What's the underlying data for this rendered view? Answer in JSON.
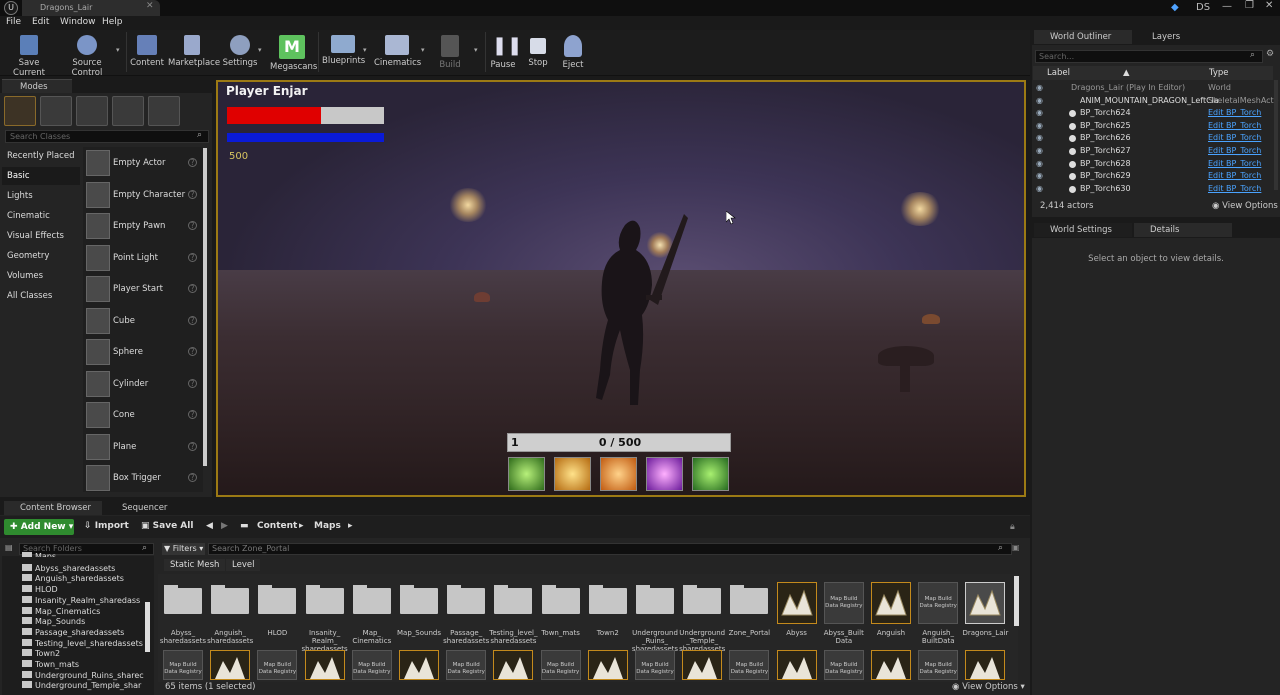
{
  "titlebar": {
    "tab_title": "Dragons_Lair",
    "user_initials": "DS",
    "close": "✕",
    "min": "—",
    "max": "❐",
    "win_close": "✕"
  },
  "menu": [
    "File",
    "Edit",
    "Window",
    "Help"
  ],
  "toolbar": [
    {
      "label": "Save Current",
      "icon": "save-icon"
    },
    {
      "label": "Source Control",
      "icon": "source-control-icon"
    },
    {
      "label": "Content",
      "icon": "content-icon"
    },
    {
      "label": "Marketplace",
      "icon": "marketplace-icon"
    },
    {
      "label": "Settings",
      "icon": "settings-icon"
    },
    {
      "label": "Megascans",
      "icon": "megascans-icon"
    },
    {
      "label": "Blueprints",
      "icon": "blueprints-icon"
    },
    {
      "label": "Cinematics",
      "icon": "cinematics-icon"
    },
    {
      "label": "Build",
      "icon": "build-icon"
    },
    {
      "label": "Pause",
      "icon": "pause-icon"
    },
    {
      "label": "Stop",
      "icon": "stop-icon"
    },
    {
      "label": "Eject",
      "icon": "eject-icon"
    }
  ],
  "modes": {
    "tab_label": "Modes",
    "search_placeholder": "Search Classes",
    "categories": [
      "Recently Placed",
      "Basic",
      "Lights",
      "Cinematic",
      "Visual Effects",
      "Geometry",
      "Volumes",
      "All Classes"
    ],
    "active_category": "Basic",
    "items": [
      "Empty Actor",
      "Empty Character",
      "Empty Pawn",
      "Point Light",
      "Player Start",
      "Cube",
      "Sphere",
      "Cylinder",
      "Cone",
      "Plane",
      "Box Trigger"
    ],
    "help": "?"
  },
  "hud": {
    "player_name": "Player Enjar",
    "health": 0.6,
    "mana": 1.0,
    "score": "500",
    "level": "1",
    "xp_text": "0  /  500",
    "skills": [
      "green-claw-skill-icon",
      "golden-burst-skill-icon",
      "fire-slash-skill-icon",
      "purple-wings-skill-icon",
      "green-slash-skill-icon"
    ]
  },
  "outliner": {
    "tab_label": "World Outliner",
    "layers_tab": "Layers",
    "search_placeholder": "Search...",
    "col_label": "Label",
    "col_type": "Type",
    "rows": [
      {
        "name": "Dragons_Lair (Play In Editor)",
        "type": "World",
        "link": false
      },
      {
        "name": "ANIM_MOUNTAIN_DRAGON_LeftCla",
        "type": "SkeletalMeshActo",
        "link": false
      },
      {
        "name": "BP_Torch624",
        "type": "Edit BP_Torch",
        "link": true
      },
      {
        "name": "BP_Torch625",
        "type": "Edit BP_Torch",
        "link": true
      },
      {
        "name": "BP_Torch626",
        "type": "Edit BP_Torch",
        "link": true
      },
      {
        "name": "BP_Torch627",
        "type": "Edit BP_Torch",
        "link": true
      },
      {
        "name": "BP_Torch628",
        "type": "Edit BP_Torch",
        "link": true
      },
      {
        "name": "BP_Torch629",
        "type": "Edit BP_Torch",
        "link": true
      },
      {
        "name": "BP_Torch630",
        "type": "Edit BP_Torch",
        "link": true
      }
    ],
    "actor_count": "2,414 actors",
    "view_options": "View Options"
  },
  "details": {
    "world_settings_tab": "World Settings",
    "details_tab": "Details",
    "empty_message": "Select an object to view details."
  },
  "content_browser": {
    "tab_label": "Content Browser",
    "sequencer_tab": "Sequencer",
    "add_new": "Add New",
    "import": "Import",
    "save_all": "Save All",
    "breadcrumb": [
      "Content",
      "Maps"
    ],
    "folder_search_placeholder": "Search Folders",
    "filters": "Filters",
    "asset_search_placeholder": "Search Zone_Portal",
    "filter_chips": [
      "Static Mesh",
      "Level"
    ],
    "folders": [
      "Maps",
      "Abyss_sharedassets",
      "Anguish_sharedassets",
      "HLOD",
      "Insanity_Realm_sharedass",
      "Map_Cinematics",
      "Map_Sounds",
      "Passage_sharedassets",
      "Testing_level_sharedassets",
      "Town2",
      "Town_mats",
      "Underground_Ruins_sharec",
      "Underground_Temple_shar"
    ],
    "assets_row1": [
      {
        "label": "Abyss_ sharedassets",
        "kind": "folder"
      },
      {
        "label": "Anguish_ sharedassets",
        "kind": "folder"
      },
      {
        "label": "HLOD",
        "kind": "folder"
      },
      {
        "label": "Insanity_ Realm_ sharedassets",
        "kind": "folder"
      },
      {
        "label": "Map_ Cinematics",
        "kind": "folder"
      },
      {
        "label": "Map_Sounds",
        "kind": "folder"
      },
      {
        "label": "Passage_ sharedassets",
        "kind": "folder"
      },
      {
        "label": "Testing_level_ sharedassets",
        "kind": "folder"
      },
      {
        "label": "Town_mats",
        "kind": "folder"
      },
      {
        "label": "Town2",
        "kind": "folder"
      },
      {
        "label": "Underground _Ruins_ sharedassets",
        "kind": "folder"
      },
      {
        "label": "Underground _Temple_ sharedassets",
        "kind": "folder"
      },
      {
        "label": "Zone_Portal",
        "kind": "folder"
      },
      {
        "label": "Abyss",
        "kind": "map"
      },
      {
        "label": "Abyss_Built Data",
        "kind": "registry"
      },
      {
        "label": "Anguish",
        "kind": "map"
      },
      {
        "label": "Anguish_ BuiltData",
        "kind": "registry"
      },
      {
        "label": "Dragons_Lair",
        "kind": "map"
      }
    ],
    "registry_caption": "Map Build Data Registry",
    "status": "65 items (1 selected)",
    "view_options": "View Options"
  }
}
